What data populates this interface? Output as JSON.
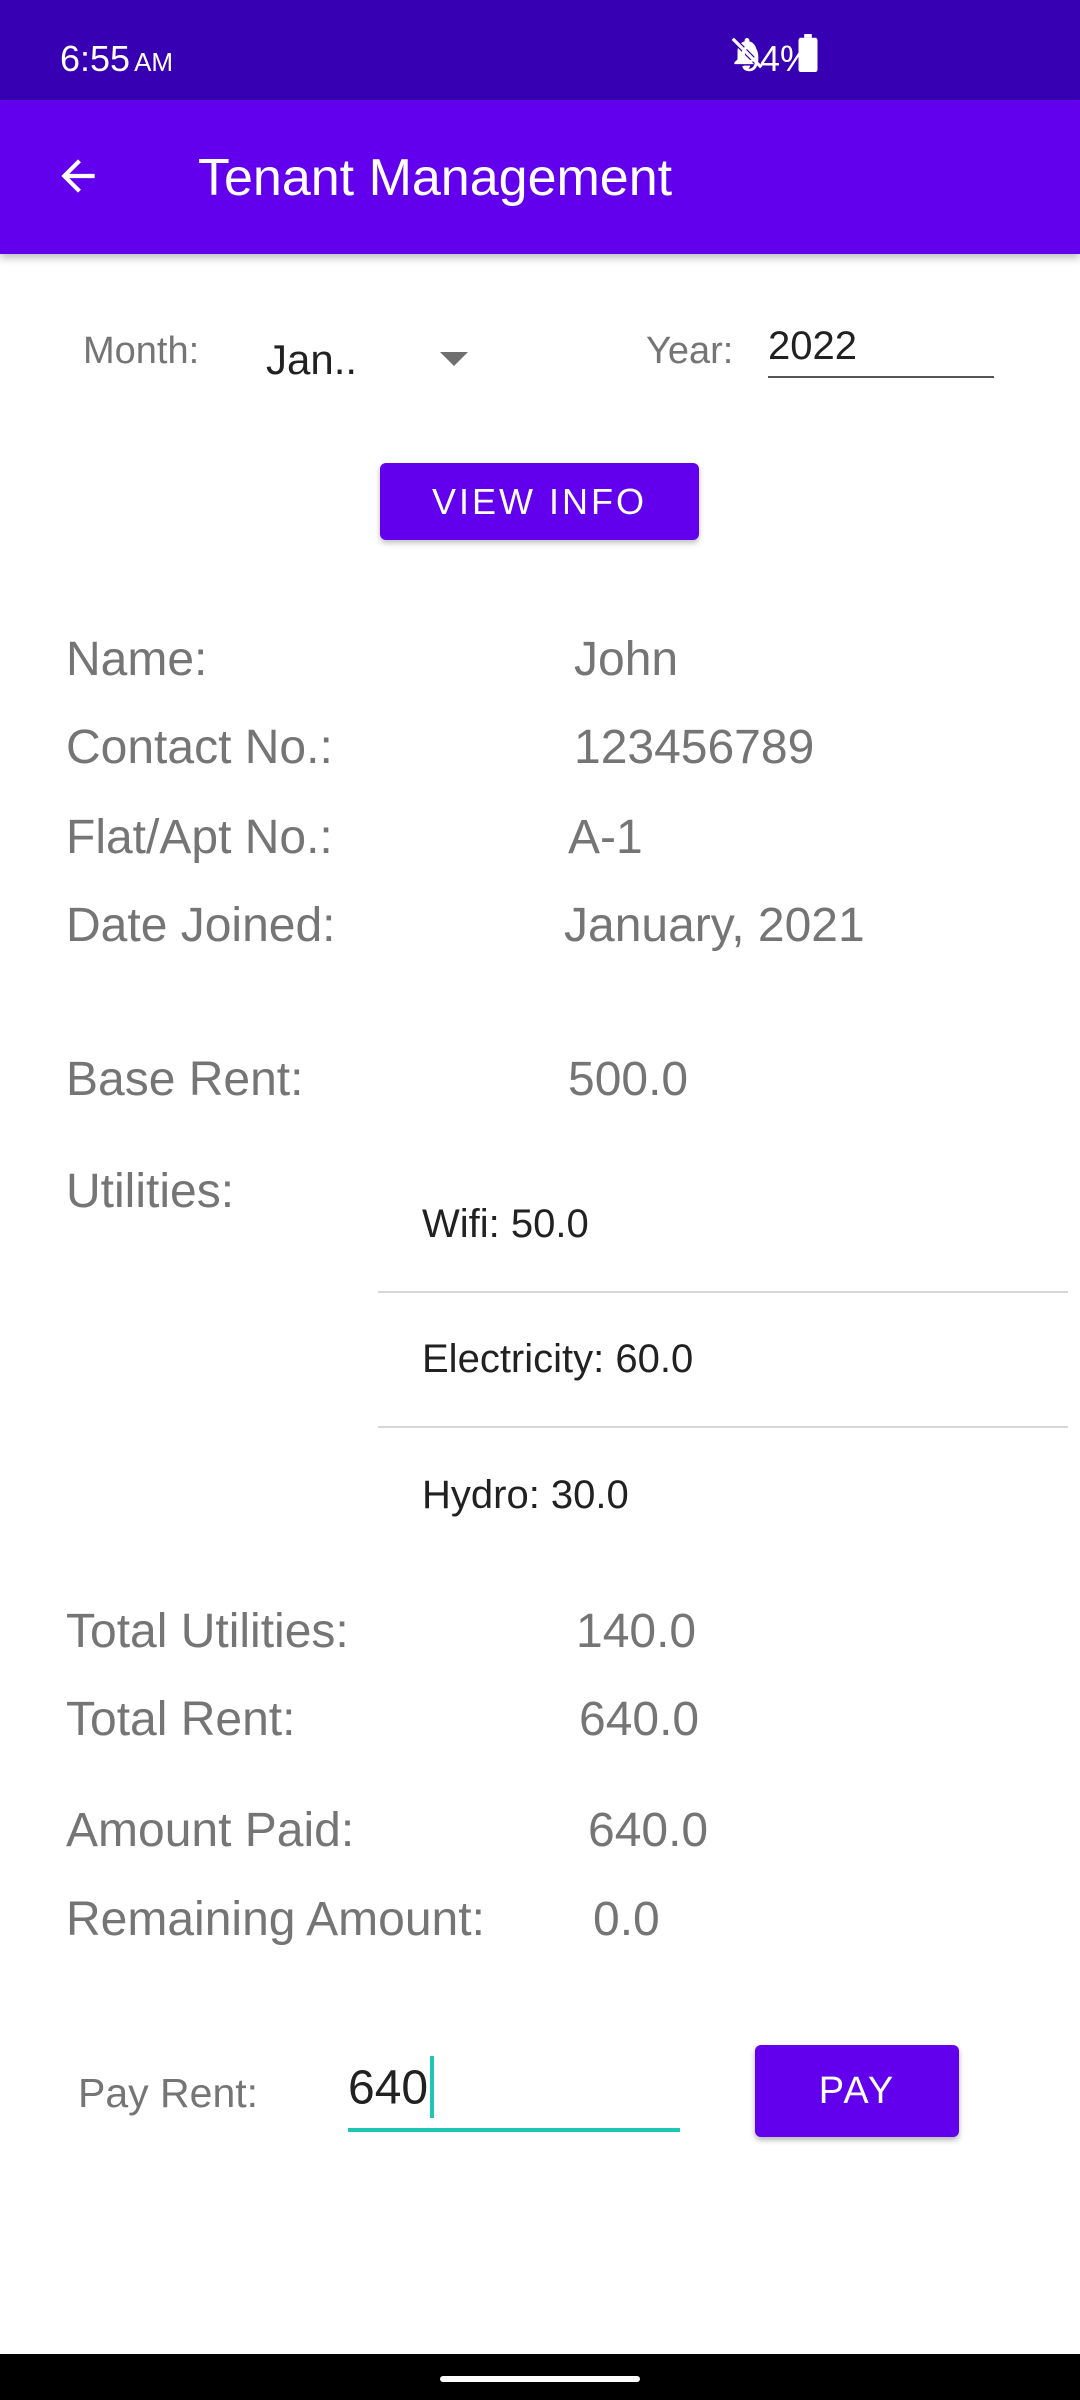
{
  "status_bar": {
    "time": "6:55",
    "ampm": "AM",
    "battery": "94%",
    "icons": [
      "notifications-off-icon",
      "battery-icon"
    ]
  },
  "app_bar": {
    "title": "Tenant Management",
    "back_icon": "arrow-back-icon"
  },
  "filters": {
    "month_label": "Month:",
    "month_value": "Jan..",
    "year_label": "Year:",
    "year_value": "2022"
  },
  "view_info_button": "VIEW INFO",
  "tenant": {
    "name_label": "Name:",
    "name_value": "John",
    "contact_label": "Contact No.:",
    "contact_value": "123456789",
    "flat_label": "Flat/Apt No.:",
    "flat_value": "A-1",
    "joined_label": "Date Joined:",
    "joined_value": "January, 2021"
  },
  "rent": {
    "base_label": "Base Rent:",
    "base_value": "500.0",
    "utilities_label": "Utilities:",
    "utilities": [
      "Wifi: 50.0",
      "Electricity: 60.0",
      "Hydro: 30.0"
    ],
    "total_utilities_label": "Total Utilities:",
    "total_utilities_value": "140.0",
    "total_rent_label": "Total Rent:",
    "total_rent_value": "640.0",
    "amount_paid_label": "Amount Paid:",
    "amount_paid_value": "640.0",
    "remaining_label": "Remaining Amount:",
    "remaining_value": "0.0"
  },
  "payment": {
    "label": "Pay Rent:",
    "input_value": "640",
    "button": "PAY"
  },
  "colors": {
    "status_bar": "#3700b3",
    "primary": "#6200ee",
    "accent": "#20c5b5"
  }
}
